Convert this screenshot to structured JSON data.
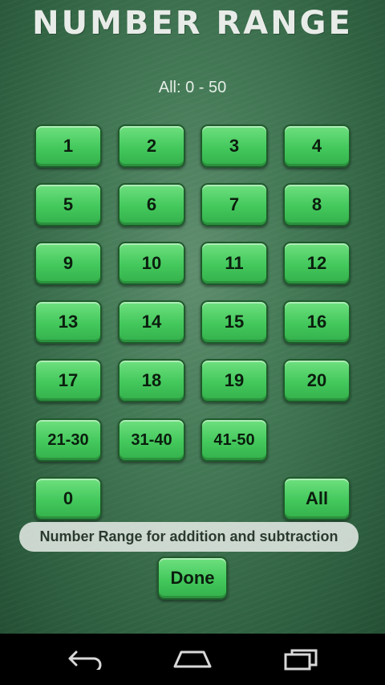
{
  "header": {
    "title": "NUMBER RANGE"
  },
  "selection": {
    "label": "All: 0 - 50"
  },
  "buttons": {
    "b1": "1",
    "b2": "2",
    "b3": "3",
    "b4": "4",
    "b5": "5",
    "b6": "6",
    "b7": "7",
    "b8": "8",
    "b9": "9",
    "b10": "10",
    "b11": "11",
    "b12": "12",
    "b13": "13",
    "b14": "14",
    "b15": "15",
    "b16": "16",
    "b17": "17",
    "b18": "18",
    "b19": "19",
    "b20": "20",
    "r21_30": "21-30",
    "r31_40": "31-40",
    "r41_50": "41-50",
    "b0": "0",
    "all": "All"
  },
  "hint": {
    "text": "Number Range for addition and subtraction"
  },
  "done": {
    "label": "Done"
  },
  "navbar": {
    "icons": [
      "back-icon",
      "home-icon",
      "recent-apps-icon"
    ]
  }
}
